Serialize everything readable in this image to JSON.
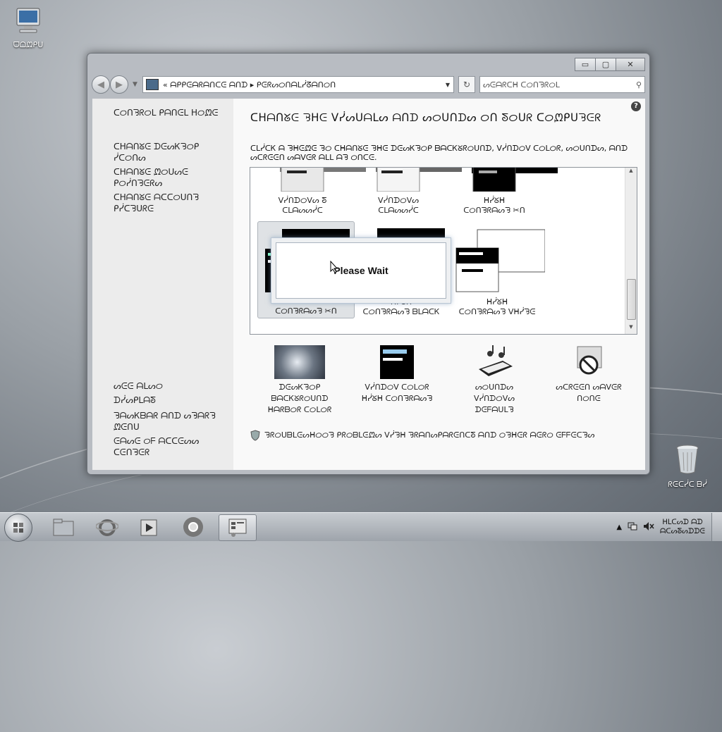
{
  "desktop": {
    "computer_label": "ᗜᗝᘻᑭᑌ",
    "recycle_label": "ᖇᕮᑕᓰᑕ ᗷᓰ"
  },
  "window": {
    "min": "▭",
    "max": "▢",
    "close": "✕"
  },
  "nav": {
    "back": "◀",
    "forward": "▶",
    "path_prefix": "«",
    "path_root": "ᗩᑭᑭᕮᗩᖇᗩᑎᑕᕮ ᗩᑎᗪ",
    "path_sep": "▸",
    "path_current": "ᑭᕮᖇᔕᝪᑎᗩᒪᓰᘔᗩᑎᝪᑎ",
    "refresh": "↻",
    "search_placeholder": "ᔕᕮᗩᖇᑕᕼ ᑕᝪᑎᘋᖇᝪᒪ",
    "search_icon": "⚲"
  },
  "left_tasks": [
    {
      "label": "ᑕᝪᑎᘋᖇᝪᒪ ᑭᗩᑎᕮᒪ ᕼᝪᘻᕮ"
    },
    {
      "label": "ᑕᕼᗩᑎᘜᕮ ᗪᕮᔕᏦᘋᝪᑭ ᓰᑕᝪᑎᔕ"
    },
    {
      "label": "ᑕᕼᗩᑎᘜᕮ ᘻᝪᑌᔕᕮ ᑭᝪᓰᑎᘋᕮᖇᔕ"
    },
    {
      "label": "ᑕᕼᗩᑎᘜᕮ ᗩᑕᑕᝪᑌᑎᘋ ᑭᓰᑕᘋᑌᖇᕮ"
    }
  ],
  "left_seealso": [
    {
      "label": "ᔕᕮᕮ ᗩᒪᔕᝪ"
    },
    {
      "label": "ᗪᓰᔕᑭᒪᗩᘕ"
    },
    {
      "label": "ᘋᗩᔕᏦᗷᗩᖇ ᗩᑎᗪ ᔕᘋᗩᖇᘋ ᘻᕮᑎᑌ"
    },
    {
      "label": "ᕮᗩᔕᕮ ᝪᖴ ᗩᑕᑕᕮᔕᔕ ᑕᕮᑎᘋᕮᖇ"
    }
  ],
  "main": {
    "help": "?",
    "heading": "ᑕᕼᗩᑎᘜᕮ ᘋᕼᕮ ᐯᓰᔕᑌᗩᒪᔕ ᗩᑎᗪ ᔕᝪᑌᑎᗪᔕ ᝪᑎ ᘕᝪᑌᖇ ᑕᝪᘻᑭᑌᘋᕮᖇ",
    "subtext": "ᑕᒪᓰᑕᏦ ᗩ ᘋᕼᕮᘻᕮ ᘋᝪ ᑕᕼᗩᑎᘜᕮ ᘋᕼᕮ ᗪᕮᔕᏦᘋᝪᑭ ᗷᗩᑕᏦᘜᖇᝪᑌᑎᗪ, ᐯᓰᑎᗪᝪᐯ ᑕᝪᒪᝪᖇ, ᔕᝪᑌᑎᗪᔕ, ᗩᑎᗪ ᔕᑕᖇᕮᕮᑎ ᔕᗩᐯᕮᖇ ᗩᒪᒪ ᗩᘋ ᝪᑎᑕᕮ."
  },
  "themes": [
    {
      "line1": "ᐯᓰᑎᗪᝪᐯᔕ ᘕ",
      "line2": "ᑕᒪᗩᔕᔕᓰᑕ"
    },
    {
      "line1": "ᐯᓰᑎᗪᝪᐯᔕ",
      "line2": "ᑕᒪᗩᔕᔕᓰᑕ"
    },
    {
      "line1": "ᕼᓰᘜᕼ",
      "line2": "ᑕᝪᑎᘋᖇᗩᔕᘋ ✂ᑎ"
    },
    {
      "line1": "ᕼᓰᘜᕼ",
      "line2": "ᑕᝪᑎᘋᖇᗩᔕᘋ ✂ᑎ"
    },
    {
      "line1": "ᕼᓰᘜᕼ",
      "line2": "ᑕᝪᑎᘋᖇᗩᔕᘋ ᗷᒪᗩᑕᏦ"
    },
    {
      "line1": "ᕼᓰᘜᕼ",
      "line2": "ᑕᝪᑎᘋᖇᗩᔕᘋ ᐯᕼᓰᘋᕮ"
    }
  ],
  "dialog": {
    "text": "Please Wait"
  },
  "bottom": [
    {
      "line1": "ᗪᕮᔕᏦᘋᝪᑭ",
      "line2": "ᗷᗩᑕᏦᘜᖇᝪᑌᑎᗪ",
      "line3": "ᕼᗩᖇᗷᝪᖇ ᑕᝪᒪᝪᖇ"
    },
    {
      "line1": "ᐯᓰᑎᗪᝪᐯ ᑕᝪᒪᝪᖇ",
      "line2": "ᕼᓰᘜᕼ ᑕᝪᑎᘋᖇᗩᔕᘋ",
      "line3": ""
    },
    {
      "line1": "ᔕᝪᑌᑎᗪᔕ",
      "line2": "ᐯᓰᑎᗪᝪᐯᔕ",
      "line3": "ᗪᕮᖴᗩᑌᒪᘋ"
    },
    {
      "line1": "ᔕᑕᖇᕮᕮᑎ ᔕᗩᐯᕮᖇ",
      "line2": "ᑎᝪᑎᕮ",
      "line3": ""
    }
  ],
  "tip": {
    "icon": "shield",
    "text": "ᘋᖇᝪᑌᗷᒪᕮᔕᕼᝪᝪᘋ ᑭᖇᝪᗷᒪᕮᘻᔕ ᐯᓰᘋᕼ ᘋᖇᗩᑎᔕᑭᗩᖇᕮᑎᑕᘕ ᗩᑎᗪ ᝪᘋᕼᕮᖇ ᗩᕮᖇᝪ ᕮᖴᖴᕮᑕᘋᔕ"
  },
  "taskbar": {
    "clock_time": "ᕼᒪᑕᔕᗪ ᗩᗪ",
    "clock_date": "ᗩᑕᔕᘕᔕᗪᗪᕮ"
  }
}
